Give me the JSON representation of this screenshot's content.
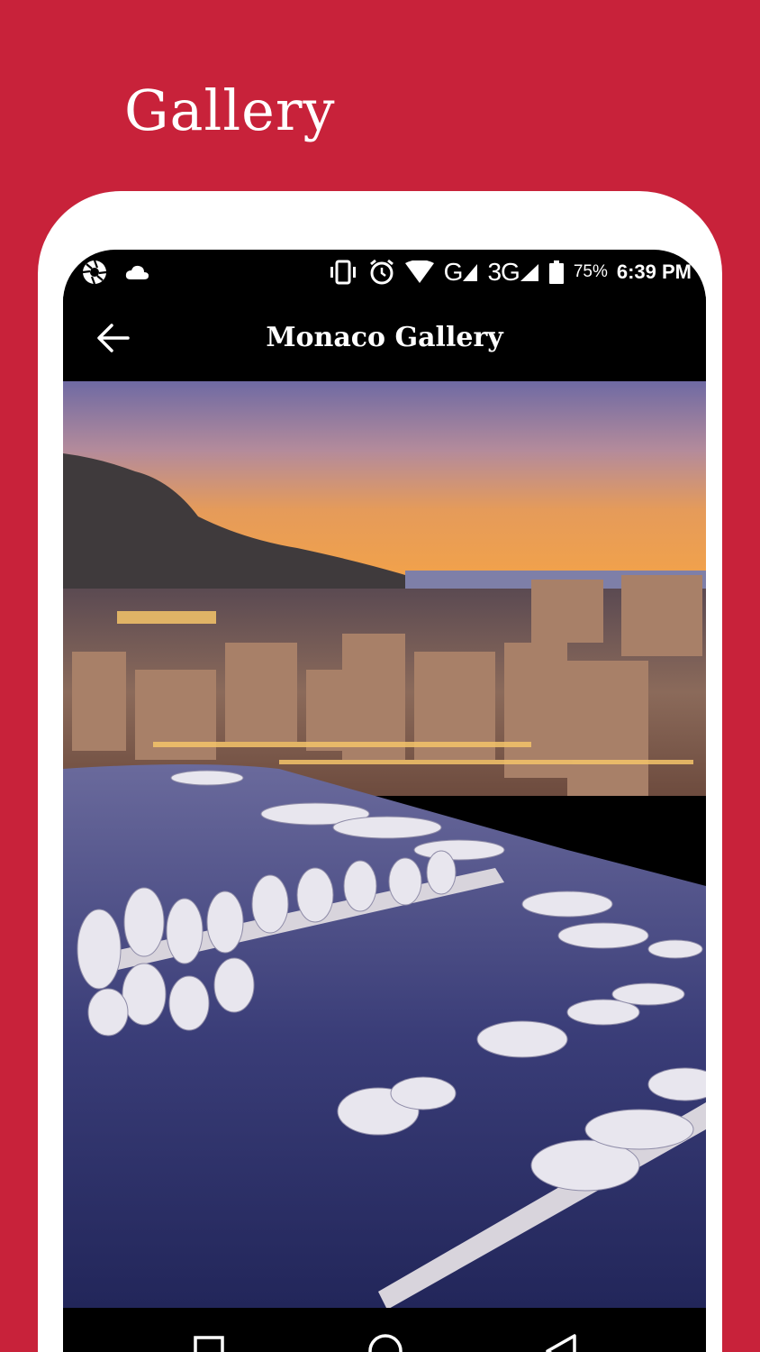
{
  "promo": {
    "title": "Gallery"
  },
  "status_bar": {
    "network_g": "G",
    "network_3g": "3G",
    "battery_percent": "75%",
    "time": "6:39 PM"
  },
  "app_bar": {
    "title": "Monaco Gallery",
    "back_icon": "arrow-left-icon"
  },
  "photo": {
    "subject": "Monaco harbour at dusk"
  },
  "nav_bar": {
    "icons": [
      "recents-square-icon",
      "home-circle-icon",
      "back-triangle-icon"
    ]
  },
  "colors": {
    "background": "#c8223a",
    "frame": "#ffffff",
    "screen": "#000000",
    "text": "#ffffff"
  }
}
